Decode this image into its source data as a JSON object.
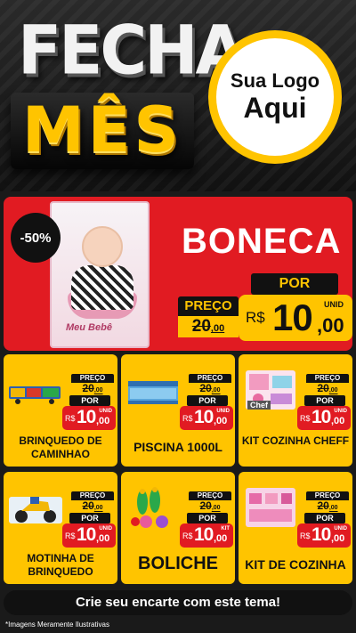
{
  "header": {
    "title_line1": "FECHA",
    "title_line2": "MÊS",
    "logo_line1": "Sua Logo",
    "logo_line2": "Aqui"
  },
  "hero": {
    "discount": "-50%",
    "product": "BONECA",
    "box_label": "Meu Bebê",
    "preco_label": "PREÇO",
    "old_int": "20",
    "old_cents": ",00",
    "por_label": "POR",
    "currency": "R$",
    "price_int": "10",
    "price_cents": ",00",
    "unit": "UNID"
  },
  "products": [
    {
      "name": "BRINQUEDO DE CAMINHAO",
      "preco_label": "PREÇO",
      "old_int": "20",
      "old_cents": ",00",
      "por_label": "POR",
      "currency": "R$",
      "price_int": "10",
      "price_cents": ",00",
      "unit": "UNID",
      "icon": "truck-toy-icon"
    },
    {
      "name": "PISCINA 1000L",
      "preco_label": "PREÇO",
      "old_int": "20",
      "old_cents": ",00",
      "por_label": "POR",
      "currency": "R$",
      "price_int": "10",
      "price_cents": ",00",
      "unit": "UNID",
      "icon": "pool-icon"
    },
    {
      "name": "KIT COZINHA CHEFF",
      "preco_label": "PREÇO",
      "old_int": "20",
      "old_cents": ",00",
      "por_label": "POR",
      "currency": "R$",
      "price_int": "10",
      "price_cents": ",00",
      "unit": "UNID",
      "icon": "kitchen-set-icon",
      "box_text": "Chef"
    },
    {
      "name": "MOTINHA DE BRINQUEDO",
      "preco_label": "PREÇO",
      "old_int": "20",
      "old_cents": ",00",
      "por_label": "POR",
      "currency": "R$",
      "price_int": "10",
      "price_cents": ",00",
      "unit": "UNID",
      "icon": "toy-motorcycle-icon"
    },
    {
      "name": "BOLICHE",
      "preco_label": "PREÇO",
      "old_int": "20",
      "old_cents": ",00",
      "por_label": "POR",
      "currency": "R$",
      "price_int": "10",
      "price_cents": ",00",
      "unit": "KIT",
      "icon": "bowling-icon"
    },
    {
      "name": "KIT DE COZINHA",
      "preco_label": "PREÇO",
      "old_int": "20",
      "old_cents": ",00",
      "por_label": "POR",
      "currency": "R$",
      "price_int": "10",
      "price_cents": ",00",
      "unit": "UNID",
      "icon": "kitchen-kit-icon"
    }
  ],
  "footer": {
    "cta": "Crie seu encarte com este tema!",
    "note": "*Imagens Meramente Ilustrativas"
  },
  "colors": {
    "yellow": "#ffc400",
    "red": "#e11b22",
    "black": "#111111"
  }
}
